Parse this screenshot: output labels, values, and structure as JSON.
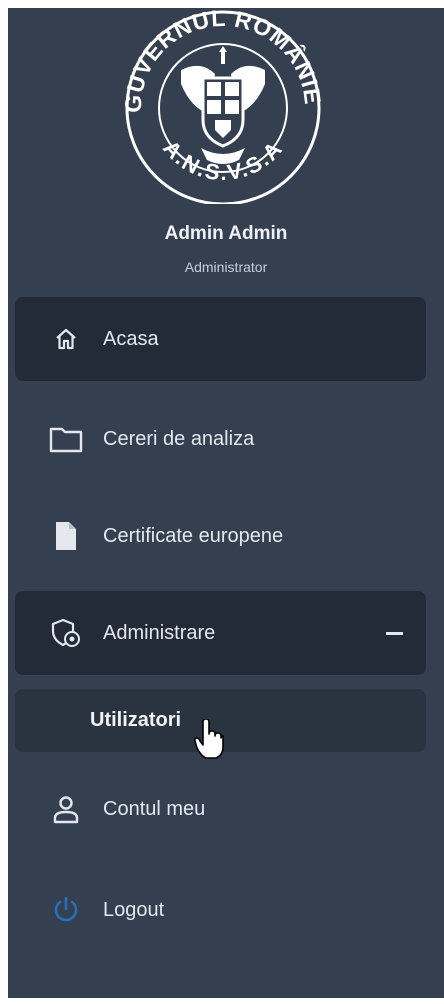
{
  "logo": {
    "name": "guvernul-romaniei-ansvsa-seal",
    "text_top": "GUVERNUL ROMÂNIEI",
    "text_bottom": "A.N.S.V.S.A"
  },
  "user": {
    "name": "Admin Admin",
    "role": "Administrator"
  },
  "nav": {
    "home": {
      "label": "Acasa",
      "icon": "home-icon"
    },
    "analysis_requests": {
      "label": "Cereri de analiza",
      "icon": "folder-icon"
    },
    "certificates": {
      "label": "Certificate europene",
      "icon": "document-icon"
    },
    "administration": {
      "label": "Administrare",
      "icon": "shield-gear-icon",
      "expanded": true,
      "toggle_icon": "minus-icon",
      "children": [
        {
          "label": "Utilizatori"
        }
      ]
    },
    "account": {
      "label": "Contul meu",
      "icon": "user-icon"
    },
    "logout": {
      "label": "Logout",
      "icon": "power-icon"
    }
  },
  "colors": {
    "sidebar_bg": "#343f50",
    "active_bg": "#222b37",
    "submenu_bg": "#2a3340",
    "text": "#e4e8ee",
    "logout_icon": "#2a6db8"
  }
}
